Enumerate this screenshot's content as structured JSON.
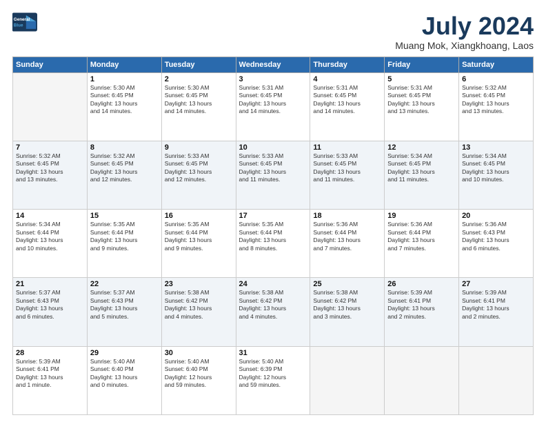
{
  "header": {
    "logo_line1": "General",
    "logo_line2": "Blue",
    "title": "July 2024",
    "subtitle": "Muang Mok, Xiangkhoang, Laos"
  },
  "days_of_week": [
    "Sunday",
    "Monday",
    "Tuesday",
    "Wednesday",
    "Thursday",
    "Friday",
    "Saturday"
  ],
  "weeks": [
    [
      {
        "num": "",
        "info": ""
      },
      {
        "num": "1",
        "info": "Sunrise: 5:30 AM\nSunset: 6:45 PM\nDaylight: 13 hours\nand 14 minutes."
      },
      {
        "num": "2",
        "info": "Sunrise: 5:30 AM\nSunset: 6:45 PM\nDaylight: 13 hours\nand 14 minutes."
      },
      {
        "num": "3",
        "info": "Sunrise: 5:31 AM\nSunset: 6:45 PM\nDaylight: 13 hours\nand 14 minutes."
      },
      {
        "num": "4",
        "info": "Sunrise: 5:31 AM\nSunset: 6:45 PM\nDaylight: 13 hours\nand 14 minutes."
      },
      {
        "num": "5",
        "info": "Sunrise: 5:31 AM\nSunset: 6:45 PM\nDaylight: 13 hours\nand 13 minutes."
      },
      {
        "num": "6",
        "info": "Sunrise: 5:32 AM\nSunset: 6:45 PM\nDaylight: 13 hours\nand 13 minutes."
      }
    ],
    [
      {
        "num": "7",
        "info": "Sunrise: 5:32 AM\nSunset: 6:45 PM\nDaylight: 13 hours\nand 13 minutes."
      },
      {
        "num": "8",
        "info": "Sunrise: 5:32 AM\nSunset: 6:45 PM\nDaylight: 13 hours\nand 12 minutes."
      },
      {
        "num": "9",
        "info": "Sunrise: 5:33 AM\nSunset: 6:45 PM\nDaylight: 13 hours\nand 12 minutes."
      },
      {
        "num": "10",
        "info": "Sunrise: 5:33 AM\nSunset: 6:45 PM\nDaylight: 13 hours\nand 11 minutes."
      },
      {
        "num": "11",
        "info": "Sunrise: 5:33 AM\nSunset: 6:45 PM\nDaylight: 13 hours\nand 11 minutes."
      },
      {
        "num": "12",
        "info": "Sunrise: 5:34 AM\nSunset: 6:45 PM\nDaylight: 13 hours\nand 11 minutes."
      },
      {
        "num": "13",
        "info": "Sunrise: 5:34 AM\nSunset: 6:45 PM\nDaylight: 13 hours\nand 10 minutes."
      }
    ],
    [
      {
        "num": "14",
        "info": "Sunrise: 5:34 AM\nSunset: 6:44 PM\nDaylight: 13 hours\nand 10 minutes."
      },
      {
        "num": "15",
        "info": "Sunrise: 5:35 AM\nSunset: 6:44 PM\nDaylight: 13 hours\nand 9 minutes."
      },
      {
        "num": "16",
        "info": "Sunrise: 5:35 AM\nSunset: 6:44 PM\nDaylight: 13 hours\nand 9 minutes."
      },
      {
        "num": "17",
        "info": "Sunrise: 5:35 AM\nSunset: 6:44 PM\nDaylight: 13 hours\nand 8 minutes."
      },
      {
        "num": "18",
        "info": "Sunrise: 5:36 AM\nSunset: 6:44 PM\nDaylight: 13 hours\nand 7 minutes."
      },
      {
        "num": "19",
        "info": "Sunrise: 5:36 AM\nSunset: 6:44 PM\nDaylight: 13 hours\nand 7 minutes."
      },
      {
        "num": "20",
        "info": "Sunrise: 5:36 AM\nSunset: 6:43 PM\nDaylight: 13 hours\nand 6 minutes."
      }
    ],
    [
      {
        "num": "21",
        "info": "Sunrise: 5:37 AM\nSunset: 6:43 PM\nDaylight: 13 hours\nand 6 minutes."
      },
      {
        "num": "22",
        "info": "Sunrise: 5:37 AM\nSunset: 6:43 PM\nDaylight: 13 hours\nand 5 minutes."
      },
      {
        "num": "23",
        "info": "Sunrise: 5:38 AM\nSunset: 6:42 PM\nDaylight: 13 hours\nand 4 minutes."
      },
      {
        "num": "24",
        "info": "Sunrise: 5:38 AM\nSunset: 6:42 PM\nDaylight: 13 hours\nand 4 minutes."
      },
      {
        "num": "25",
        "info": "Sunrise: 5:38 AM\nSunset: 6:42 PM\nDaylight: 13 hours\nand 3 minutes."
      },
      {
        "num": "26",
        "info": "Sunrise: 5:39 AM\nSunset: 6:41 PM\nDaylight: 13 hours\nand 2 minutes."
      },
      {
        "num": "27",
        "info": "Sunrise: 5:39 AM\nSunset: 6:41 PM\nDaylight: 13 hours\nand 2 minutes."
      }
    ],
    [
      {
        "num": "28",
        "info": "Sunrise: 5:39 AM\nSunset: 6:41 PM\nDaylight: 13 hours\nand 1 minute."
      },
      {
        "num": "29",
        "info": "Sunrise: 5:40 AM\nSunset: 6:40 PM\nDaylight: 13 hours\nand 0 minutes."
      },
      {
        "num": "30",
        "info": "Sunrise: 5:40 AM\nSunset: 6:40 PM\nDaylight: 12 hours\nand 59 minutes."
      },
      {
        "num": "31",
        "info": "Sunrise: 5:40 AM\nSunset: 6:39 PM\nDaylight: 12 hours\nand 59 minutes."
      },
      {
        "num": "",
        "info": ""
      },
      {
        "num": "",
        "info": ""
      },
      {
        "num": "",
        "info": ""
      }
    ]
  ]
}
